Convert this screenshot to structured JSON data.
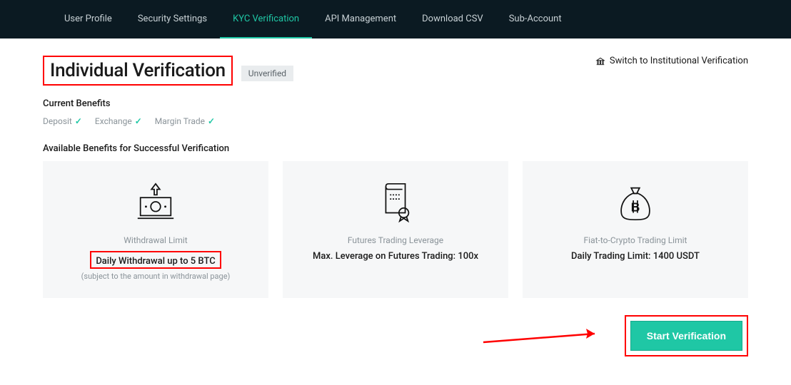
{
  "nav": {
    "items": [
      {
        "label": "User Profile",
        "active": false
      },
      {
        "label": "Security Settings",
        "active": false
      },
      {
        "label": "KYC Verification",
        "active": true
      },
      {
        "label": "API Management",
        "active": false
      },
      {
        "label": "Download CSV",
        "active": false
      },
      {
        "label": "Sub-Account",
        "active": false
      }
    ]
  },
  "header": {
    "title": "Individual Verification",
    "status": "Unverified",
    "switch_label": "Switch to Institutional Verification"
  },
  "current_benefits": {
    "label": "Current Benefits",
    "items": [
      {
        "label": "Deposit"
      },
      {
        "label": "Exchange"
      },
      {
        "label": "Margin Trade"
      }
    ]
  },
  "available_benefits": {
    "label": "Available Benefits for Successful Verification",
    "cards": [
      {
        "icon": "money-out-icon",
        "title": "Withdrawal Limit",
        "value": "Daily Withdrawal up to 5 BTC",
        "note": "(subject to the amount in withdrawal page)"
      },
      {
        "icon": "certificate-icon",
        "title": "Futures Trading Leverage",
        "value": "Max. Leverage on Futures Trading: 100x",
        "note": ""
      },
      {
        "icon": "fiat-bag-icon",
        "title": "Fiat-to-Crypto Trading Limit",
        "value": "Daily Trading Limit: 1400 USDT",
        "note": ""
      }
    ]
  },
  "cta": {
    "label": "Start Verification"
  },
  "annotations": {
    "title_highlighted": true,
    "card0_value_highlighted": true,
    "cta_highlighted": true,
    "arrow_to_cta": true
  },
  "colors": {
    "accent": "#1fc7a5",
    "nav_bg": "#0b1a22",
    "card_bg": "#f6f7f8",
    "highlight": "#ff0000"
  }
}
